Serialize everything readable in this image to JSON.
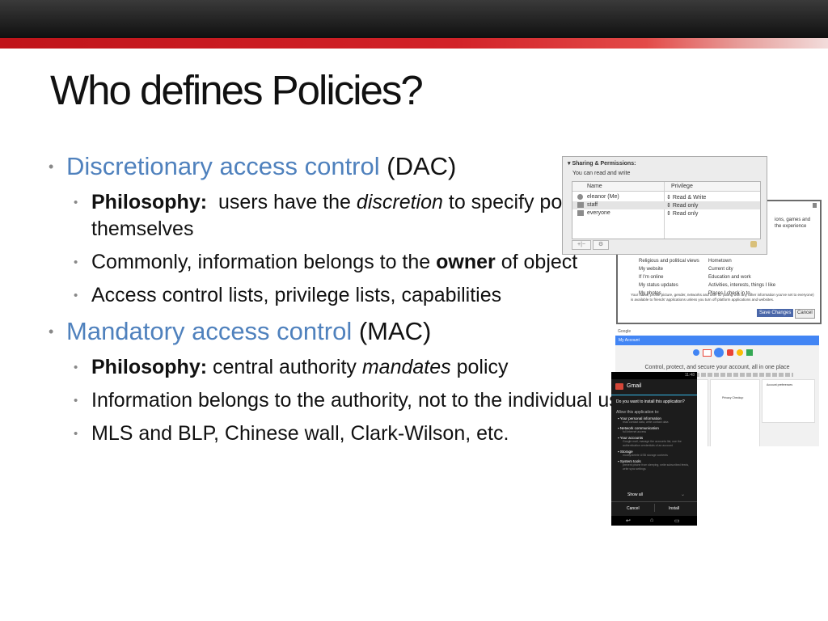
{
  "slide": {
    "title": "Who defines Policies?"
  },
  "dac": {
    "term": "Discretionary access control",
    "abbr": "(DAC)",
    "items": [
      {
        "bold": "Philosophy:",
        "text1": "users have the",
        "em": "discretion",
        "text2": "to specify policy",
        "wrap": "themselves"
      },
      {
        "text1": "Commonly, information belongs to the",
        "bold": "owner",
        "text2": "of object"
      },
      {
        "text": "Access control lists, privilege lists, capabilities"
      }
    ]
  },
  "mac": {
    "term": "Mandatory access control",
    "abbr": "(MAC)",
    "items": [
      {
        "bold": "Philosophy:",
        "text1": "central authority",
        "em": "mandates",
        "text2": "policy"
      },
      {
        "text": "Information belongs to the authority, not to the individual users"
      },
      {
        "text": "MLS and BLP, Chinese wall, Clark-Wilson, etc."
      }
    ]
  },
  "screenshot_mac": {
    "header": "Sharing & Permissions:",
    "subheader": "You can read and write",
    "col_name": "Name",
    "col_priv": "Privilege",
    "rows": [
      {
        "name": "eleanor (Me)",
        "priv": "Read & Write"
      },
      {
        "name": "staff",
        "priv": "Read only"
      },
      {
        "name": "everyone",
        "priv": "Read only"
      }
    ]
  },
  "screenshot_fb": {
    "top_right1": "ions, games and",
    "top_right2": "the experience",
    "left_items": [
      "Religious and political views",
      "My website",
      "If I'm online",
      "My status updates",
      "My photos"
    ],
    "right_items": [
      "Hometown",
      "Current city",
      "Education and work",
      "Activities, interests, things I like",
      "Places I check in to"
    ],
    "footer": "Your name, profile picture, gender, networks and user ID (along with any other information you've set to everyone) is available to friends' applications unless you turn off platform applications and websites.",
    "save_label": "Save Changes",
    "cancel_label": "Cancel"
  },
  "screenshot_google": {
    "brand": "Google",
    "bar": "My Account",
    "heading": "Control, protect, and secure your account, all in one place",
    "card1": "Personal info & privacy",
    "card2": "Account preferences",
    "card3": "Privacy Checkup"
  },
  "screenshot_android": {
    "status_time": "11:48",
    "app": "Gmail",
    "question": "Do you want to install this application?",
    "allow": "Allow this application to:",
    "perms": [
      {
        "title": "Your personal information",
        "desc": "read contact data, write contact data"
      },
      {
        "title": "Network communication",
        "desc": "full Internet access"
      },
      {
        "title": "Your accounts",
        "desc": "Google mail, manage the accounts list, use the authentication credentials of an account"
      },
      {
        "title": "Storage",
        "desc": "modify/delete USB storage contents"
      },
      {
        "title": "System tools",
        "desc": "prevent phone from sleeping, write subscribed feeds, write sync settings"
      }
    ],
    "show_all": "Show all",
    "cancel": "Cancel",
    "install": "Install"
  },
  "colors": {
    "accent_blue": "#4f81bd",
    "header_red": "#c0141a"
  }
}
